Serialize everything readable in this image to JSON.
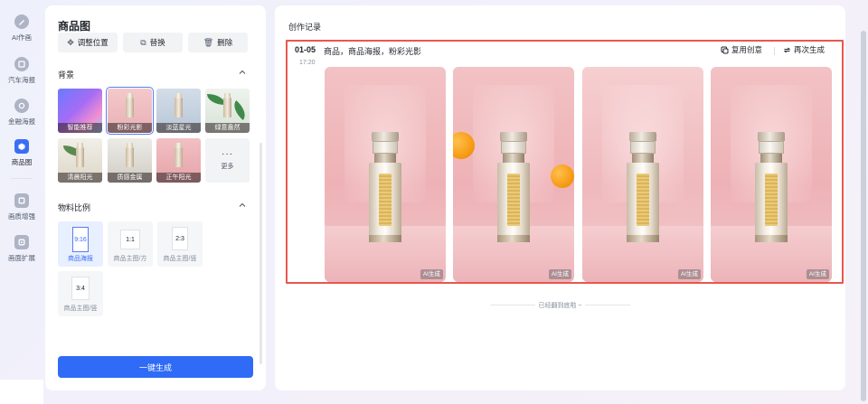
{
  "sidebar": {
    "items": [
      {
        "label": "AI作画",
        "icon": "brush-icon"
      },
      {
        "label": "汽车海报",
        "icon": "car-icon"
      },
      {
        "label": "金融海报",
        "icon": "coin-icon"
      },
      {
        "label": "商品图",
        "icon": "product-icon",
        "active": true
      },
      {
        "label": "画质增强",
        "icon": "enhance-icon"
      },
      {
        "label": "画面扩展",
        "icon": "expand-icon"
      }
    ]
  },
  "panel": {
    "title": "商品图",
    "toolbar": {
      "adjust_label": "调整位置",
      "replace_label": "替换",
      "delete_label": "删除"
    },
    "background": {
      "title": "背景",
      "options": [
        {
          "label": "智能推荐"
        },
        {
          "label": "粉彩光影",
          "selected": true
        },
        {
          "label": "淡蓝星光"
        },
        {
          "label": "绿意盎然"
        },
        {
          "label": "清晨阳光"
        },
        {
          "label": "质感金属"
        },
        {
          "label": "正午阳光"
        }
      ],
      "more_label": "更多"
    },
    "ratio": {
      "title": "物料比例",
      "options": [
        {
          "ratio": "9:16",
          "caption": "商品海报",
          "selected": true
        },
        {
          "ratio": "1:1",
          "caption": "商品主图/方"
        },
        {
          "ratio": "2:3",
          "caption": "商品主图/竖"
        },
        {
          "ratio": "3:4",
          "caption": "商品主图/竖"
        }
      ]
    },
    "generate_label": "一键生成"
  },
  "history": {
    "title": "创作记录",
    "record": {
      "date": "01-05",
      "time": "17:20",
      "prompt": "商品，商品海报，粉彩光影",
      "reuse_label": "复用创意",
      "regenerate_label": "再次生成",
      "images": [
        {
          "badge": "AI生成"
        },
        {
          "badge": "AI生成"
        },
        {
          "badge": "AI生成"
        },
        {
          "badge": "AI生成"
        }
      ]
    },
    "end_note": "已经翻到底啦 ~"
  },
  "colors": {
    "accent": "#2f6bf6",
    "highlight_border": "#e8574f",
    "pink_backdrop": "#eeb2b6"
  }
}
